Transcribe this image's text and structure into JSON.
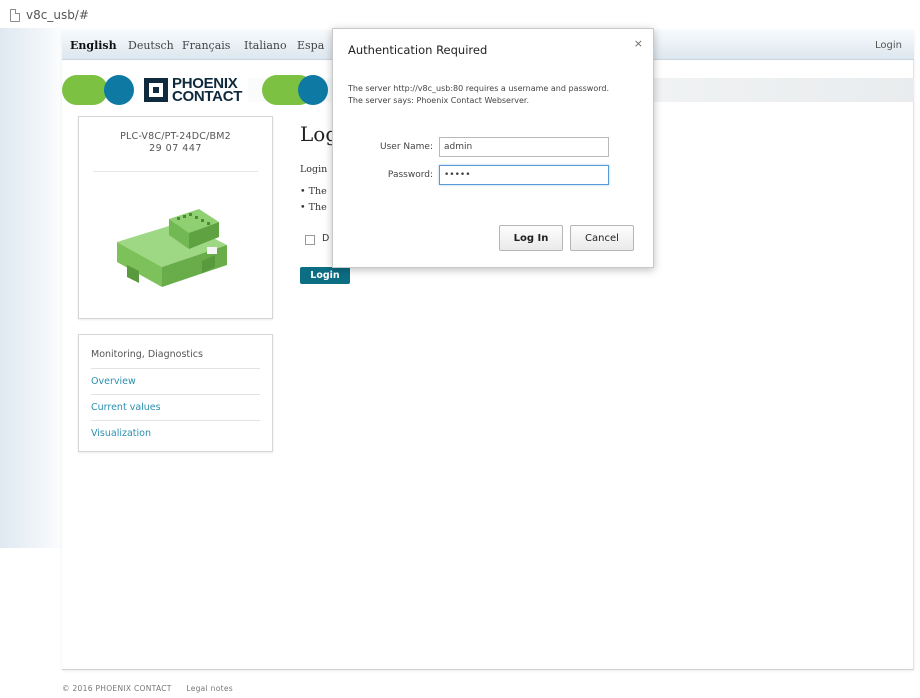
{
  "browser": {
    "tab_title": "v8c_usb/#"
  },
  "header": {
    "languages": [
      "English",
      "Deutsch",
      "Français",
      "Italiano",
      "Espa"
    ],
    "login_label": "Login"
  },
  "brand": {
    "logo_line1": "PHOENIX",
    "logo_line2": "CONTACT",
    "green": "#7cc142",
    "blue": "#0e7aa3",
    "accent": "#0b6e83"
  },
  "device": {
    "name": "PLC-V8C/PT-24DC/BM2",
    "id": "29 07 447"
  },
  "nav": {
    "heading": "Monitoring, Diagnostics",
    "items": [
      "Overview",
      "Current values",
      "Visualization"
    ]
  },
  "main": {
    "title": "Log",
    "lead": "Login",
    "bullets": [
      "The",
      "The"
    ],
    "checkbox_label": "D",
    "login_button": "Login"
  },
  "dialog": {
    "title": "Authentication Required",
    "close": "×",
    "message": "The server http://v8c_usb:80 requires a username and password. The server says: Phoenix Contact Webserver.",
    "username_label": "User Name:",
    "username_value": "admin",
    "password_label": "Password:",
    "password_value": "•••••",
    "login_button": "Log In",
    "cancel_button": "Cancel"
  },
  "footer": {
    "copyright": "© 2016 PHOENIX CONTACT",
    "legal": "Legal notes"
  }
}
